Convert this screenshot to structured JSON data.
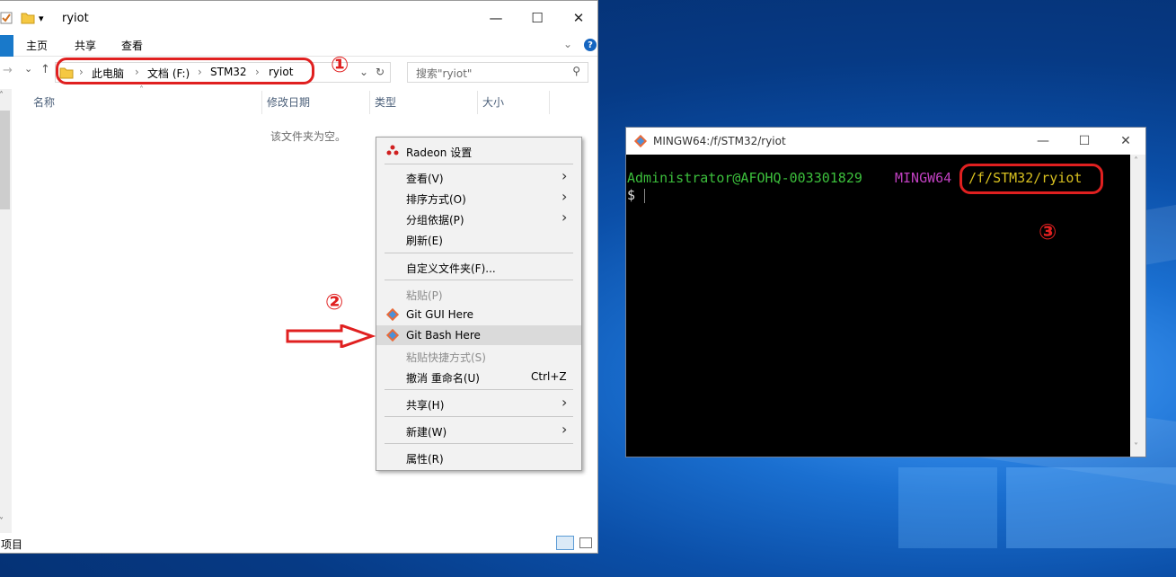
{
  "explorer": {
    "title": "ryiot",
    "ribbon_tabs": [
      "主页",
      "共享",
      "查看"
    ],
    "help": "?",
    "breadcrumbs": [
      "此电脑",
      "文档 (F:)",
      "STM32",
      "ryiot"
    ],
    "search_placeholder": "搜索\"ryiot\"",
    "columns": [
      "名称",
      "修改日期",
      "类型",
      "大小"
    ],
    "empty_message": "该文件夹为空。",
    "status_text": "项目"
  },
  "annotations": {
    "marker_1": "①",
    "marker_2": "②",
    "marker_3": "③",
    "color": "#e02020"
  },
  "context_menu": {
    "items": [
      {
        "label": "Radeon 设置",
        "icon": "radeon-icon"
      },
      {
        "label": "查看(V)",
        "submenu": true
      },
      {
        "label": "排序方式(O)",
        "submenu": true
      },
      {
        "label": "分组依据(P)",
        "submenu": true
      },
      {
        "label": "刷新(E)"
      },
      {
        "label": "自定义文件夹(F)..."
      },
      {
        "label": "粘贴(P)",
        "disabled": true
      },
      {
        "label": "Git GUI Here",
        "icon": "git-icon"
      },
      {
        "label": "Git Bash Here",
        "icon": "git-icon",
        "highlighted": true
      },
      {
        "label": "粘贴快捷方式(S)",
        "disabled": true
      },
      {
        "label": "撤消 重命名(U)",
        "shortcut": "Ctrl+Z"
      },
      {
        "label": "共享(H)",
        "submenu": true
      },
      {
        "label": "新建(W)",
        "submenu": true
      },
      {
        "label": "属性(R)"
      }
    ]
  },
  "terminal": {
    "title": "MINGW64:/f/STM32/ryiot",
    "user_host": "Administrator@AFOHQ-003301829",
    "env": "MINGW64",
    "path": "/f/STM32/ryiot",
    "prompt": "$",
    "colors": {
      "user": "#3cbf3c",
      "env": "#c040c0",
      "path": "#d8c020"
    }
  }
}
